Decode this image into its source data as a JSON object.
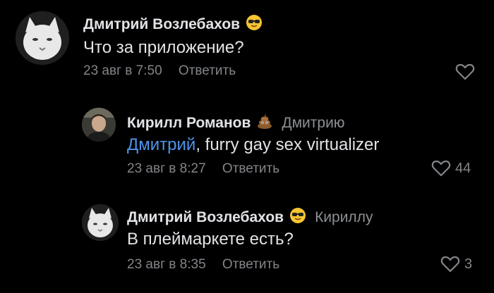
{
  "comments": [
    {
      "author": "Дмитрий Возлебахов",
      "author_emoji": "sunglasses-face-emoji",
      "reply_to": "",
      "mention": "",
      "text": "Что за приложение?",
      "date": "23 авг в 7:50",
      "reply_label": "Ответить",
      "likes": ""
    },
    {
      "author": "Кирилл Романов",
      "author_emoji": "pile-of-poo-emoji",
      "reply_to": "Дмитрию",
      "mention": "Дмитрий",
      "text": ", furry gay sex virtualizer",
      "date": "23 авг в 8:27",
      "reply_label": "Ответить",
      "likes": "44"
    },
    {
      "author": "Дмитрий Возлебахов",
      "author_emoji": "sunglasses-face-emoji",
      "reply_to": "Кириллу",
      "mention": "",
      "text": "В плеймаркете есть?",
      "date": "23 авг в 8:35",
      "reply_label": "Ответить",
      "likes": "3"
    }
  ],
  "colors": {
    "background": "#000000",
    "text": "#e1e3e6",
    "secondary": "#828589",
    "link": "#4f93e8"
  }
}
